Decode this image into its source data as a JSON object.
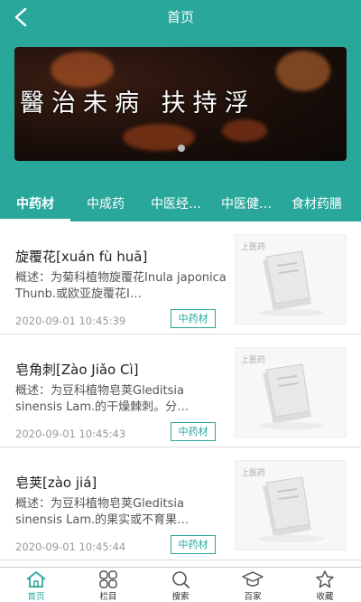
{
  "header": {
    "title": "首页"
  },
  "banner": {
    "text": "醫治未病 扶持浮"
  },
  "tabs": [
    {
      "label": "中药材"
    },
    {
      "label": "中成药"
    },
    {
      "label": "中医经…"
    },
    {
      "label": "中医健…"
    },
    {
      "label": "食材药膳"
    }
  ],
  "items": [
    {
      "title": "旋覆花[xuán fù huā]",
      "desc": "概述：为菊科植物旋覆花Inula japonica Thunb.或欧亚旋覆花I…",
      "time": "2020-09-01 10:45:39",
      "tag": "中药材",
      "thumb_logo": "上医药"
    },
    {
      "title": "皂角刺[Zào Jiǎo Cì]",
      "desc": "概述：为豆科植物皂荚Gleditsia sinensis Lam.的干燥棘刺。分…",
      "time": "2020-09-01 10:45:43",
      "tag": "中药材",
      "thumb_logo": "上医药"
    },
    {
      "title": "皂荚[zào jiá]",
      "desc": "概述：为豆科植物皂荚Gleditsia sinensis Lam.的果实或不育果…",
      "time": "2020-09-01 10:45:44",
      "tag": "中药材",
      "thumb_logo": "上医药"
    }
  ],
  "bottom_nav": [
    {
      "label": "首页",
      "icon": "home-icon"
    },
    {
      "label": "栏目",
      "icon": "grid-icon"
    },
    {
      "label": "搜索",
      "icon": "search-icon"
    },
    {
      "label": "百家",
      "icon": "graduation-cap-icon"
    },
    {
      "label": "收藏",
      "icon": "star-icon"
    }
  ],
  "colors": {
    "accent": "#2aa79b",
    "banner_bg": "#1b0e0a"
  }
}
